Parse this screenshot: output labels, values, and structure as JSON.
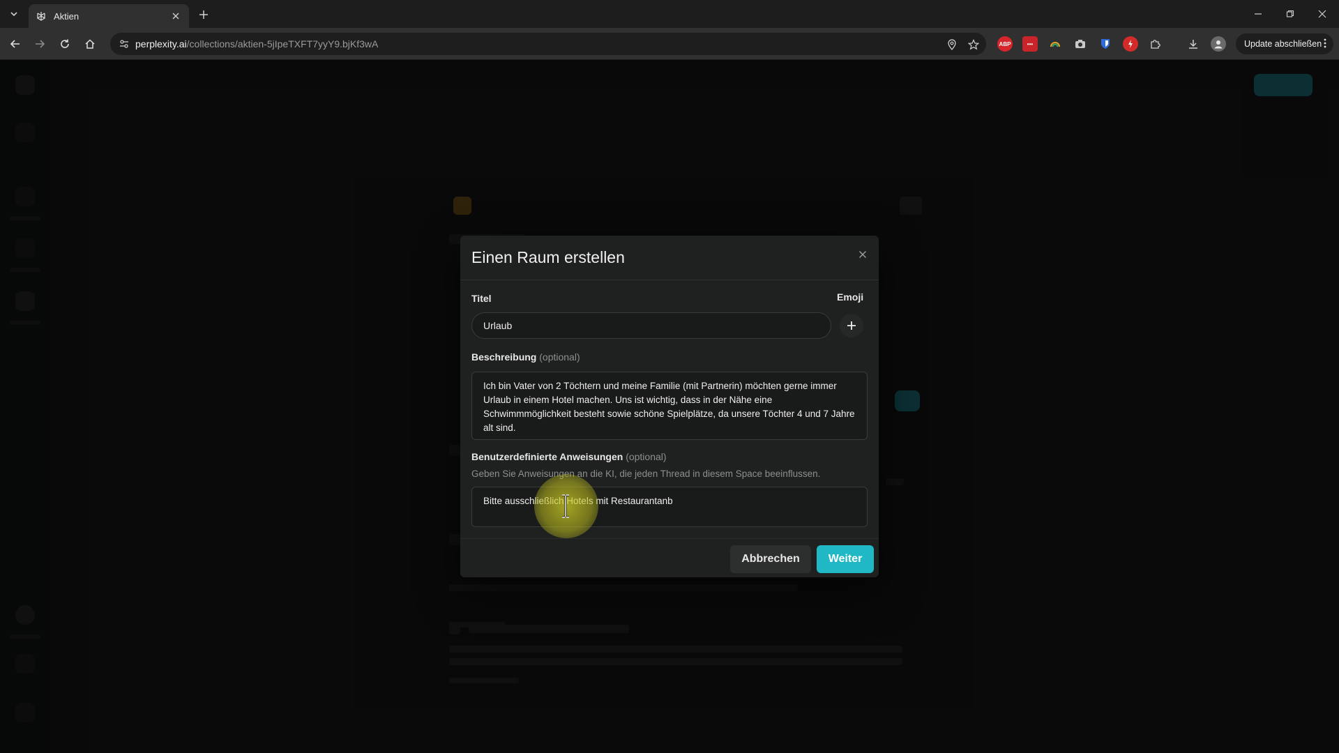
{
  "browser": {
    "tab_title": "Aktien",
    "url_host": "perplexity.ai",
    "url_path": "/collections/aktien-5jIpeTXFT7yyY9.bjKf3wA",
    "update_label": "Update abschließen"
  },
  "modal": {
    "title": "Einen Raum erstellen",
    "title_label": "Titel",
    "emoji_label": "Emoji",
    "title_value": "Urlaub",
    "description_label": "Beschreibung",
    "optional": "(optional)",
    "description_value": "Ich bin Vater von 2 Töchtern und meine Familie (mit Partnerin) möchten gerne immer Urlaub in einem Hotel machen. Uns ist wichtig, dass in der Nähe eine Schwimmmöglichkeit besteht sowie schöne Spielplätze, da unsere Töchter 4 und 7 Jahre alt sind.",
    "instructions_label": "Benutzerdefinierte Anweisungen",
    "instructions_hint": "Geben Sie Anweisungen an die KI, die jeden Thread in diesem Space beeinflussen.",
    "instructions_value": "Bitte ausschließlich Hotels mit Restaurantanb",
    "cancel_label": "Abbrechen",
    "next_label": "Weiter"
  },
  "colors": {
    "accent": "#20b8c5",
    "modal_bg": "#1f2020",
    "page_bg": "#191a1a"
  }
}
